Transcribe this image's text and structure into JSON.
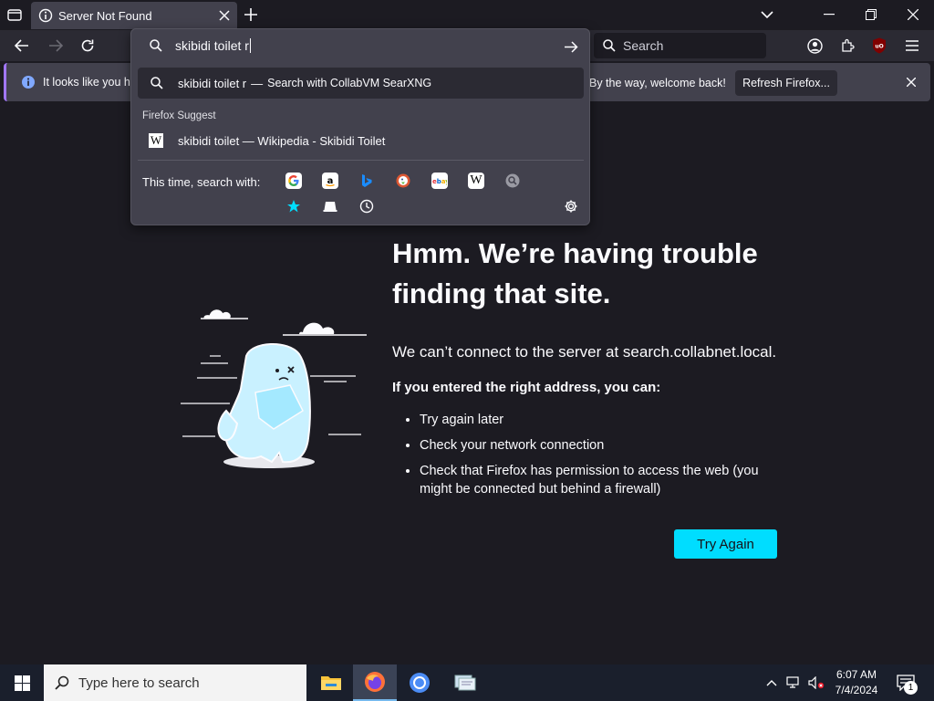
{
  "tab": {
    "title": "Server Not Found"
  },
  "urlbar": {
    "value": "skibidi toilet r"
  },
  "searchbar": {
    "placeholder": "Search"
  },
  "dropdown": {
    "first_row_query": "skibidi toilet r",
    "first_row_sep": "—",
    "first_row_action": "Search with CollabVM SearXNG",
    "suggest_heading": "Firefox Suggest",
    "suggest_item": "skibidi toilet — Wikipedia - Skibidi Toilet",
    "search_with_label": "This time, search with:",
    "engines": [
      "Google",
      "Amazon",
      "Bing",
      "DuckDuckGo",
      "eBay",
      "Wikipedia",
      "Search"
    ]
  },
  "notification": {
    "text_left": "It looks like you ha",
    "text_right": "By the way, welcome back!",
    "button": "Refresh Firefox..."
  },
  "error_page": {
    "headline": "Hmm. We’re having trouble finding that site.",
    "lead": "We can’t connect to the server at search.collabnet.local.",
    "subhead": "If you entered the right address, you can:",
    "tips": [
      "Try again later",
      "Check your network connection",
      "Check that Firefox has permission to access the web (you might be connected but behind a firewall)"
    ],
    "button": "Try Again"
  },
  "taskbar": {
    "search_placeholder": "Type here to search",
    "time": "6:07 AM",
    "date": "7/4/2024",
    "notification_count": "1"
  },
  "colors": {
    "accent": "#00ddff",
    "background": "#1c1b22",
    "panel": "#42414d"
  }
}
